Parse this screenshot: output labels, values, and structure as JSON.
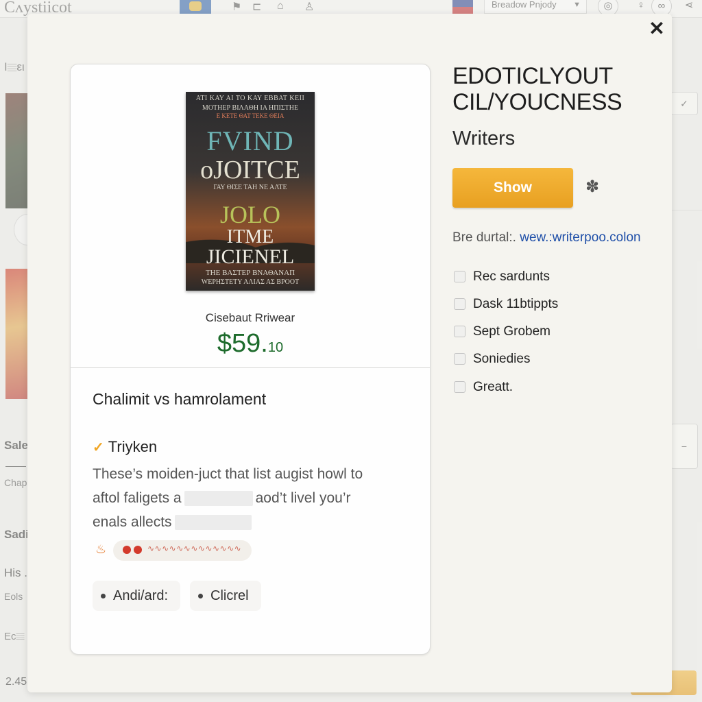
{
  "background": {
    "logo": "Cʌystiicot",
    "top_icons": [
      "tag-icon",
      "cart-icon",
      "basket-icon",
      "bell-icon"
    ],
    "dropdown_label": "Breadow Pnjody",
    "left_labels": {
      "l1": "Ι𝄙ει",
      "sale": "Sale",
      "chap": "Chap",
      "sadi": "Sadi",
      "his": "His .",
      "eols": "Eols",
      "ecm": "Ec𝄙"
    },
    "bottom_number": "2.45"
  },
  "modal": {
    "close_label": "✕",
    "product": {
      "cover": {
        "line1": "ΑΤΙ ΚΑΥ ΑΙ ΤΟ ΚΑΥ ΕΒΒΑΤ ΚΕΙΙ",
        "line2": "ΜΟΤΗΕΡ ΒΙΛΑΘΗ ΙΑ ΗΠΙΣΤΗΕ",
        "line3": "Ε ΚΕΤΕ ΘΑΤ ΤΕΚΕ ΘΕΙΑ",
        "title_a": "FVIND",
        "title_b": "oJOITCE",
        "line6": "ΓΑΥ ΘΙΣΕ ΤΑΗ ΝΕ ΑΛΤΕ",
        "title_c": "JOLO",
        "title_d": "ITME",
        "title_e": "JICIENEL",
        "line10": "ΤΗΕ ΒΑΣΤΕΡ ΒΝΑΘΑΝΑΠ",
        "line11": "WΕΡΗΣΤΕΤΥ ΑΛΙΑΣ ΑΣ ΒΡΟΟΤ"
      },
      "author": "Cisebaut Rriwear",
      "price_main": "$59.",
      "price_cents": "10"
    },
    "details": {
      "section_title": "Chalimit vs hamrolament",
      "check_label": "Triyken",
      "desc_line1": "These’s moiden-juct that list augist howl to",
      "desc_line2_a": "aftol faligets a",
      "desc_line2_b": "aod’t livel you’r",
      "desc_line3": "enals allects",
      "chips": [
        "Andi/ard:",
        "Clicrel"
      ]
    },
    "side": {
      "heading_line1": "EDOTICLYOUT",
      "heading_line2": "CIL/YOUCNESS",
      "subheading": "Writers",
      "show_button": "Show",
      "url_label": "Bre durtal:.",
      "url_link": "wew.:writerpoo.colon",
      "options": [
        "Rec sardunts",
        "Dask 11btippts",
        "Sept Grobem",
        "Soniedies",
        "Greatt."
      ]
    }
  },
  "colors": {
    "accent": "#eba52a",
    "price": "#1d6b2c",
    "link": "#1f4fa8",
    "brand_check": "#f0a522"
  }
}
